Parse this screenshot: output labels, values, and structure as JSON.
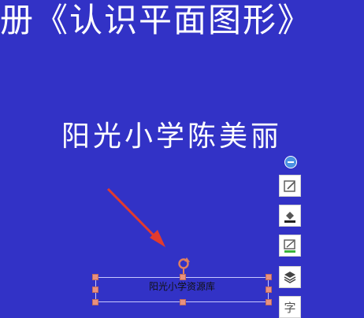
{
  "slide": {
    "title": "册《认识平面图形》",
    "author": "阳光小学陈美丽"
  },
  "textbox": {
    "text": "阳光小学资源库"
  },
  "toolbar": {
    "items": [
      "collapse-icon",
      "edit-shape-icon",
      "fill-color-icon",
      "outline-color-icon",
      "layers-icon",
      "text-icon"
    ],
    "text_glyph": "字"
  },
  "colors": {
    "background": "#3232c6",
    "arrow": "#e23b2e",
    "handle": "#e8907f"
  }
}
